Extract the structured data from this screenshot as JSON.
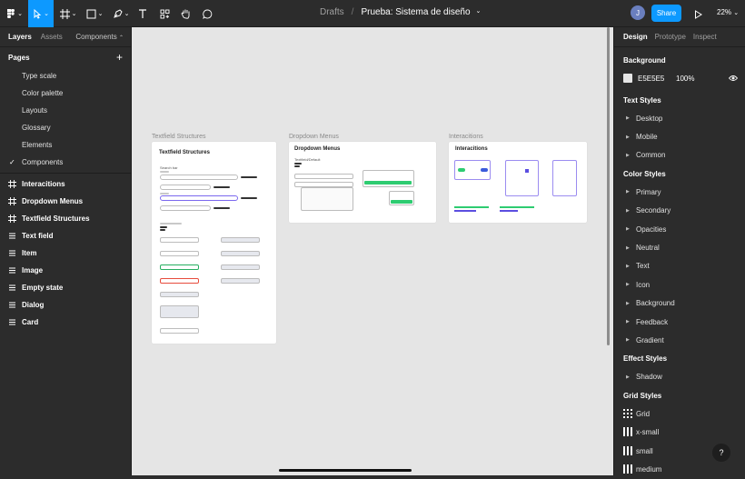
{
  "toolbar": {
    "file_location": "Drafts",
    "separator": "/",
    "file_name": "Prueba: Sistema de diseño",
    "avatar_initial": "J",
    "share_label": "Share",
    "zoom_label": "22%"
  },
  "left_panel": {
    "tabs": [
      "Layers",
      "Assets"
    ],
    "components_label": "Components",
    "pages_label": "Pages",
    "pages": [
      "Type scale",
      "Color palette",
      "Layouts",
      "Glossary",
      "Elements",
      "Components"
    ],
    "layers": [
      {
        "label": "Interacitions",
        "icon": "frame-icon"
      },
      {
        "label": "Dropdown Menus",
        "icon": "frame-icon"
      },
      {
        "label": "Textfield Structures",
        "icon": "frame-icon"
      },
      {
        "label": "Text field",
        "icon": "stack-icon"
      },
      {
        "label": "Item",
        "icon": "stack-icon"
      },
      {
        "label": "Image",
        "icon": "stack-icon"
      },
      {
        "label": "Empty state",
        "icon": "stack-icon"
      },
      {
        "label": "Dialog",
        "icon": "stack-icon"
      },
      {
        "label": "Card",
        "icon": "stack-icon"
      }
    ]
  },
  "canvas": {
    "frames": [
      {
        "label": "Textfield Structures",
        "title": "Textfield Structures",
        "subtitle": "Search bar"
      },
      {
        "label": "Dropdown Menus",
        "title": "Dropdown Menus",
        "subtitle": "Textfield/Default"
      },
      {
        "label": "Interacitions",
        "title": "Interacitions"
      }
    ]
  },
  "right_panel": {
    "tabs": [
      "Design",
      "Prototype",
      "Inspect"
    ],
    "background_title": "Background",
    "background_hex": "E5E5E5",
    "background_opacity": "100%",
    "background_color": "#e5e5e5",
    "text_styles_title": "Text Styles",
    "text_styles": [
      "Desktop",
      "Mobile",
      "Common"
    ],
    "color_styles_title": "Color Styles",
    "color_styles": [
      "Primary",
      "Secondary",
      "Opacities",
      "Neutral",
      "Text",
      "Icon",
      "Background",
      "Feedback",
      "Gradient"
    ],
    "effect_styles_title": "Effect Styles",
    "effect_styles": [
      "Shadow"
    ],
    "grid_styles_title": "Grid Styles",
    "grid_styles": [
      "Grid",
      "x-small",
      "small",
      "medium"
    ]
  },
  "help_label": "?",
  "colors": {
    "accent": "#0d99ff",
    "panel": "#2c2c2c",
    "canvas": "#e5e5e5"
  }
}
